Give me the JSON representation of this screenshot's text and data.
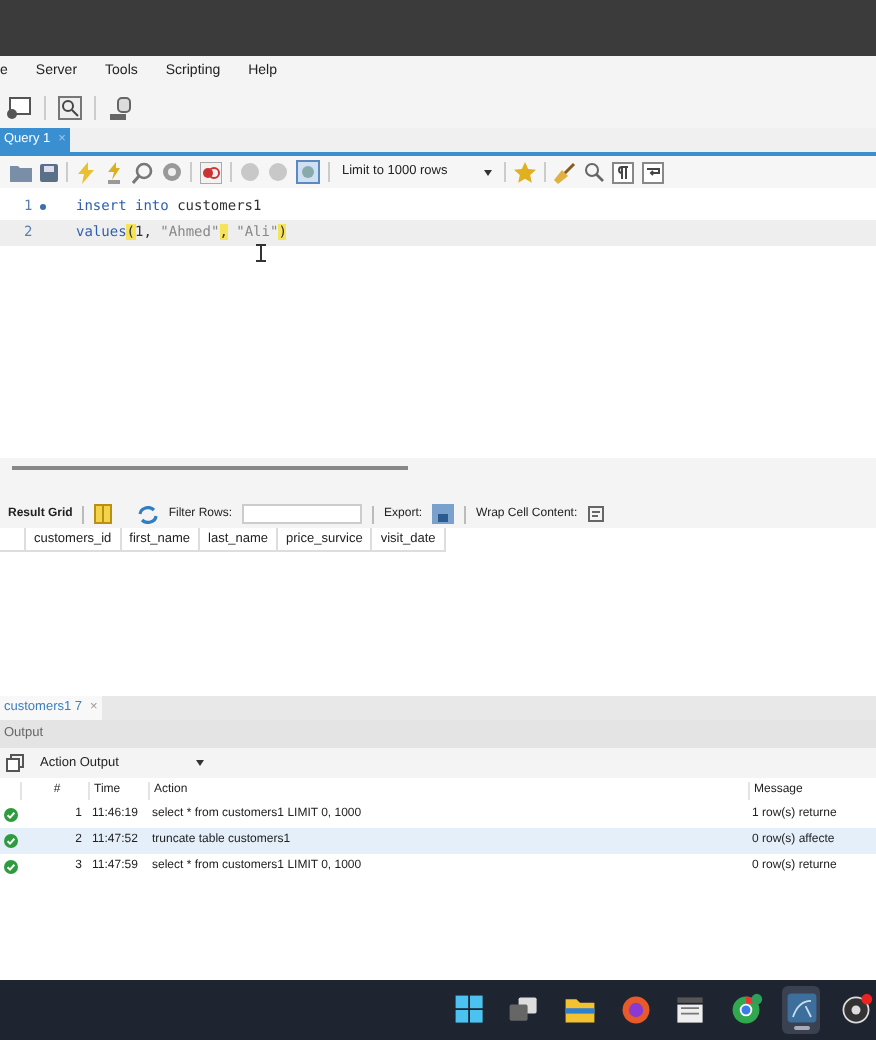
{
  "menu": [
    "e",
    "Server",
    "Tools",
    "Scripting",
    "Help"
  ],
  "query_tabs": [
    {
      "label": "Query 1",
      "close": "×",
      "selected": true
    }
  ],
  "editor_toolbar": {
    "limit": "Limit to 1000 rows",
    "toggle_on": true
  },
  "editor": {
    "lines": [
      {
        "number": "1",
        "marker": true,
        "current": false,
        "tokens": [
          {
            "text": "insert into",
            "kind": "keyword"
          },
          {
            "text": " customers1",
            "kind": "plain"
          }
        ]
      },
      {
        "number": "2",
        "marker": false,
        "current": true,
        "tokens": [
          {
            "text": "values",
            "kind": "keyword"
          },
          {
            "text": "(",
            "kind": "match"
          },
          {
            "text": "1, ",
            "kind": "plain"
          },
          {
            "text": "\"Ahmed\"",
            "kind": "string"
          },
          {
            "text": ",",
            "kind": "match"
          },
          {
            "text": " \"Ali\"",
            "kind": "string"
          },
          {
            "text": ")",
            "kind": "match"
          }
        ]
      }
    ]
  },
  "result_toolbar": {
    "title": "Result Grid",
    "filter_label": "Filter Rows:",
    "export_label": "Export:",
    "wrap_label": "Wrap Cell Content:"
  },
  "result_columns": [
    "customers_id",
    "first_name",
    "last_name",
    "price_survice",
    "visit_date"
  ],
  "result_tabs": [
    {
      "label": "customers1 7",
      "close": "×",
      "selected": true
    }
  ],
  "output": {
    "title": "Output",
    "selector": "Action Output",
    "columns": [
      "#",
      "Time",
      "Action",
      "Message"
    ],
    "rows": [
      {
        "succeeded": true,
        "number": "1",
        "time": "11:46:19",
        "action": "select * from customers1 LIMIT 0, 1000",
        "message": "1 row(s) returne",
        "selected": false
      },
      {
        "succeeded": true,
        "number": "2",
        "time": "11:47:52",
        "action": "truncate table customers1",
        "message": "0 row(s) affecte",
        "selected": true
      },
      {
        "succeeded": true,
        "number": "3",
        "time": "11:47:59",
        "action": "select * from customers1 LIMIT 0, 1000",
        "message": "0 row(s) returne",
        "selected": false
      }
    ]
  },
  "taskbar": [
    {
      "kind": "start",
      "selected": false
    },
    {
      "kind": "taskview",
      "selected": false
    },
    {
      "kind": "folder",
      "selected": false
    },
    {
      "kind": "browser",
      "selected": false
    },
    {
      "kind": "media",
      "selected": false
    },
    {
      "kind": "chrome",
      "selected": false
    },
    {
      "kind": "workbench",
      "selected": true
    },
    {
      "kind": "recorder",
      "selected": false
    }
  ]
}
